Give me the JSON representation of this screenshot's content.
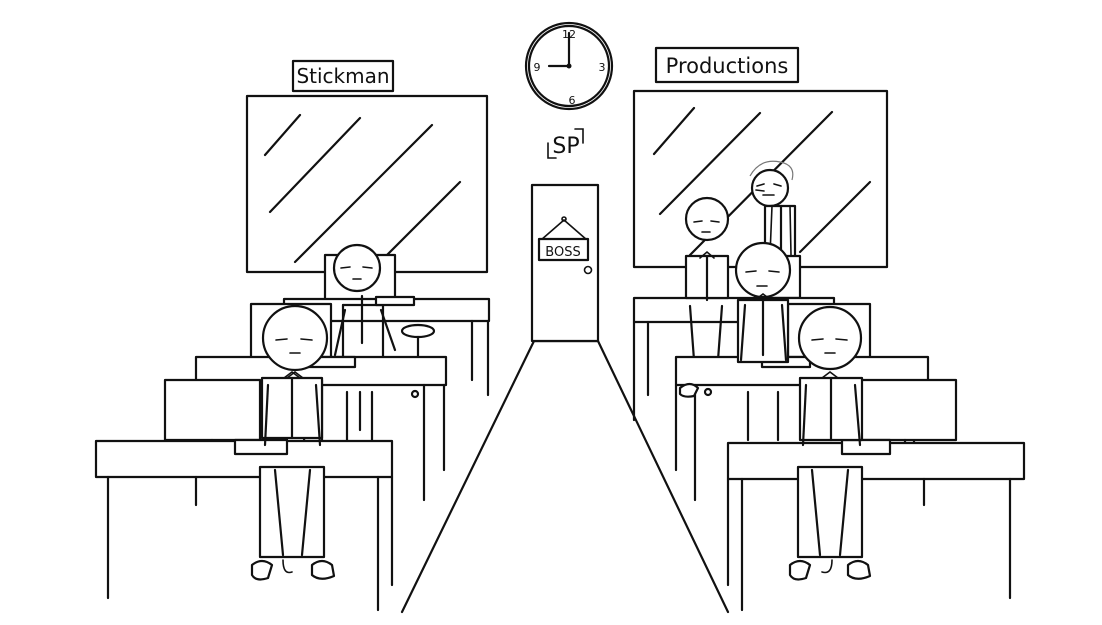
{
  "signs": {
    "left": "Stickman",
    "right": "Productions",
    "door": "BOSS",
    "logo": "SP"
  },
  "clock": {
    "numerals": [
      "12",
      "3",
      "6",
      "9"
    ],
    "time": "9:00"
  }
}
